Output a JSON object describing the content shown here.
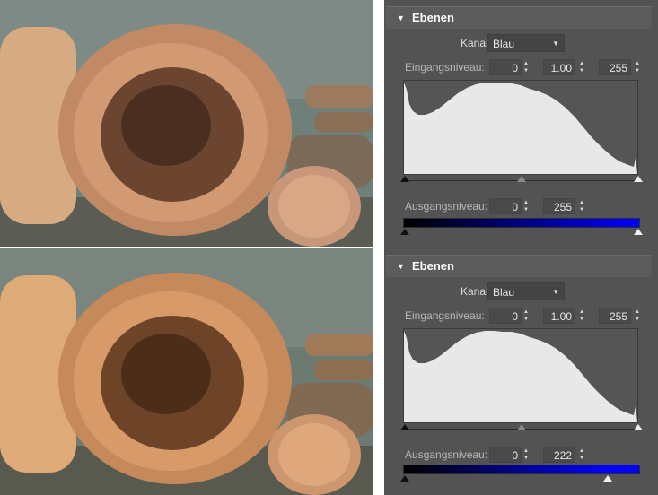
{
  "panels": [
    {
      "title": "Ebenen",
      "channel_label": "Kanal:",
      "channel_value": "Blau",
      "input_label": "Eingangsniveau:",
      "input_black": "0",
      "input_gamma": "1.00",
      "input_white": "255",
      "output_label": "Ausgangsniveau:",
      "output_black": "0",
      "output_white": "255",
      "output_white_fraction": 1.0,
      "gradient_end_color": "#0000ff"
    },
    {
      "title": "Ebenen",
      "channel_label": "Kanal:",
      "channel_value": "Blau",
      "input_label": "Eingangsniveau:",
      "input_black": "0",
      "input_gamma": "1.00",
      "input_white": "255",
      "output_label": "Ausgangsniveau:",
      "output_black": "0",
      "output_white": "222",
      "output_white_fraction": 0.87,
      "gradient_end_color": "#0000ff"
    }
  ],
  "icons": {
    "collapse": "triangle-down-icon",
    "spinner": "up-down-arrows-icon",
    "dropdown": "chevron-down-icon"
  },
  "colors": {
    "panel_bg": "#535353",
    "histogram_fill": "#e8e8e8"
  }
}
